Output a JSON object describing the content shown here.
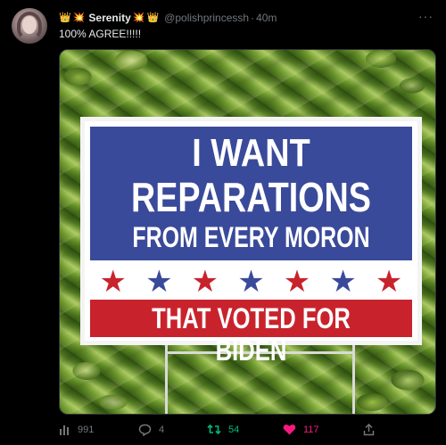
{
  "tweet": {
    "display_name": "Serenity",
    "name_emojis_left": [
      "👑",
      "💥"
    ],
    "name_emojis_right": [
      "💥",
      "👑"
    ],
    "handle": "@polishprincessh",
    "separator": "·",
    "time": "40m",
    "more_label": "···",
    "text": "100% AGREE!!!!!"
  },
  "image": {
    "sign_line_1": "I WANT",
    "sign_line_2": "REPARATIONS",
    "sign_line_3": "FROM EVERY MORON",
    "sign_line_4": "THAT VOTED FOR BIDEN",
    "stars": [
      "red",
      "blue",
      "red",
      "blue",
      "red",
      "blue",
      "red"
    ]
  },
  "actions": {
    "views": "991",
    "replies": "4",
    "retweets": "54",
    "likes": "117"
  },
  "colors": {
    "background": "#000000",
    "text_primary": "#e7e9ea",
    "text_secondary": "#71767b",
    "retweet_green": "#00ba7c",
    "like_pink": "#f91880",
    "sign_blue": "#3a4a9a",
    "sign_red": "#c8232c"
  },
  "icons": {
    "views": "bar-chart-icon",
    "replies": "reply-bubble-icon",
    "retweets": "retweet-icon",
    "likes": "heart-icon",
    "share": "share-icon",
    "more": "more-dots-icon"
  }
}
